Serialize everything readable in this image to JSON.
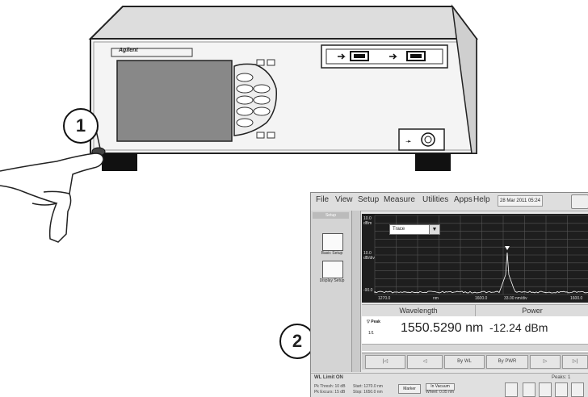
{
  "callouts": {
    "step1": "1",
    "step2": "2"
  },
  "instrument": {
    "brand_label": "Agilent",
    "icons": [
      "usb-port-icon",
      "usb-port-icon",
      "optical-input-connector-icon",
      "power-button-icon"
    ]
  },
  "screen": {
    "menu": {
      "file": "File",
      "view": "View",
      "setup": "Setup",
      "measure": "Measure",
      "utilities": "Utilities",
      "apps": "Apps",
      "help": "Help",
      "datetime": "28 Mar 2011 05:24"
    },
    "side_panel": {
      "tab": "Setup",
      "basic_setup": "Basic Setup",
      "display_setup": "Display Setup"
    },
    "plot": {
      "y_top": "10.0",
      "y_top_unit": "dBm",
      "y_mid": "10.0",
      "y_mid_unit": "dB/div",
      "y_bottom": "-90.0",
      "x_left": "1270.0",
      "x_unit": "nm",
      "x_center_label": "1600.0",
      "x_span_label": "33.00 nm/div",
      "x_right": "1600.0",
      "marker_dropdown": "Trace"
    },
    "table": {
      "col_wavelength": "Wavelength",
      "col_power": "Power",
      "row_label": "Peak",
      "row_index": "1/1",
      "wavelength_value": "1550.5290 nm",
      "power_value": "-12.24 dBm"
    },
    "toolbar": {
      "by_wl": "By WL",
      "by_pwr": "By PWR"
    },
    "status": {
      "wl_limit": "WL Limit ON",
      "peaks": "Peaks:  1",
      "pk_thresh": "Pk Thresh: 10 dB",
      "pk_excursion": "Pk Excurs: 15 dB",
      "start": "Start:  1270.0 nm",
      "stop": "Stop:  1650.0 nm",
      "marker_btn": "Marker",
      "in_vacuum": "In Vacuum",
      "wheel": "Wheel:  0.05 nm"
    }
  },
  "colors": {
    "plot_bg": "#1e1e1e",
    "grid": "#555555",
    "trace": "#ffffff"
  }
}
